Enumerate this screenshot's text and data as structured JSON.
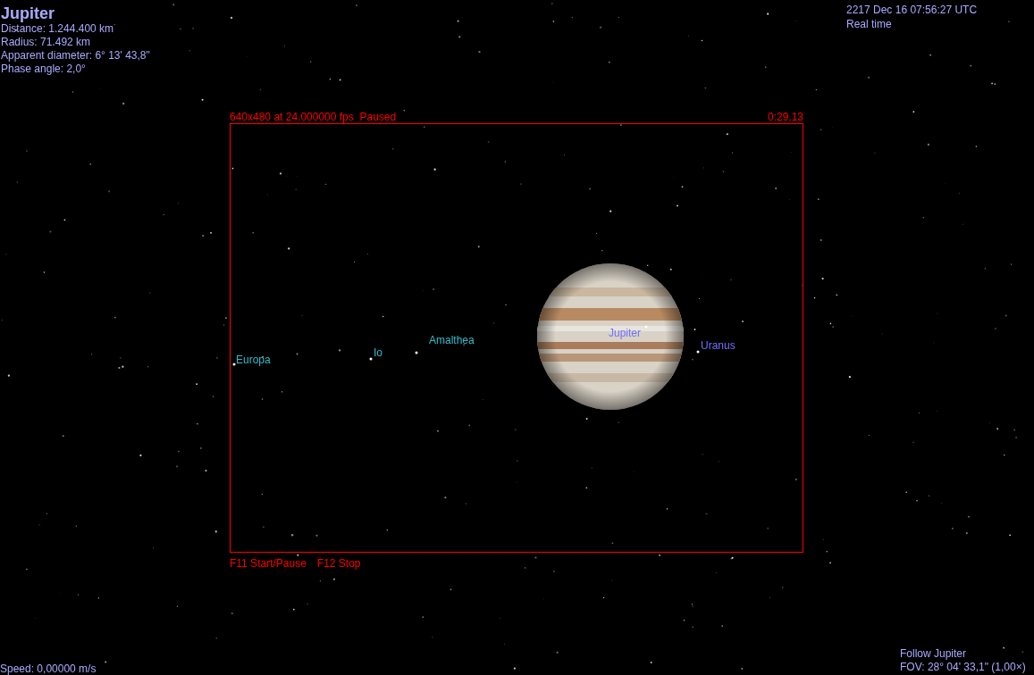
{
  "object_info": {
    "name": "Jupiter",
    "lines": [
      "Distance: 1.244.400 km",
      "Radius: 71.492 km",
      "Apparent diameter: 6° 13' 43,8\"",
      "Phase angle: 2,0°"
    ]
  },
  "time_info": {
    "date": "2217 Dec 16 07:56:27 UTC",
    "rate": "Real time"
  },
  "recording": {
    "status": "640x480 at 24.000000 fps  Paused",
    "elapsed": "0:29,13",
    "hints": [
      "F11 Start/Pause",
      "F12 Stop"
    ]
  },
  "labels": [
    {
      "text": "Europa",
      "kind": "moon"
    },
    {
      "text": "Io",
      "kind": "moon"
    },
    {
      "text": "Amalthea",
      "kind": "moon"
    },
    {
      "text": "Jupiter",
      "kind": "planet"
    },
    {
      "text": "Uranus",
      "kind": "planet"
    }
  ],
  "speed": "Speed: 0,00000 m/s",
  "view_info": {
    "mode": "Follow Jupiter",
    "fov": "FOV: 28° 04' 33,1\" (1,00×)"
  }
}
